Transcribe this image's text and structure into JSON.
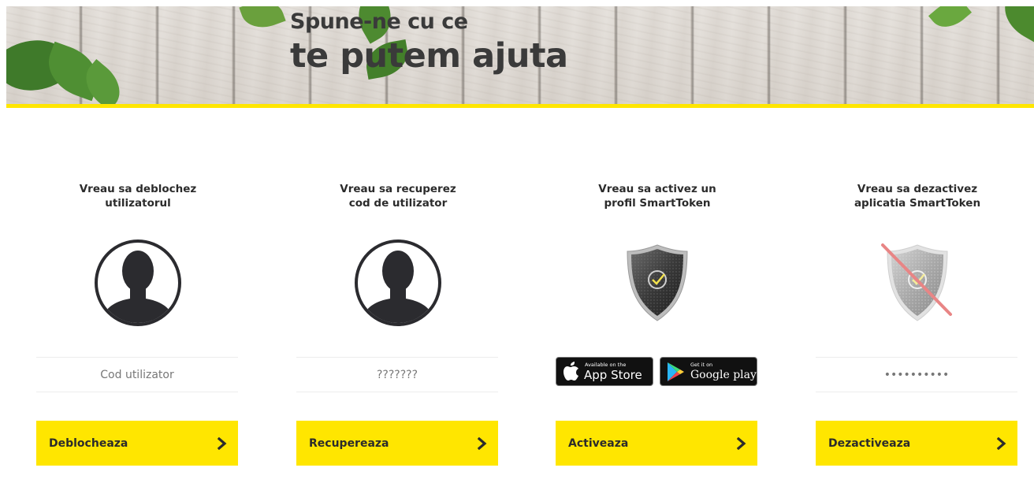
{
  "hero": {
    "title_line1": "Spune-ne cu ce",
    "title_line2": "te putem ajuta",
    "accent_color": "#ffe600"
  },
  "cards": [
    {
      "title_line1": "Vreau sa deblochez",
      "title_line2": "utilizatorul",
      "icon": "user-silhouette-icon",
      "input_placeholder": "Cod utilizator",
      "button_label": "Deblocheaza"
    },
    {
      "title_line1": "Vreau sa recuperez",
      "title_line2": "cod de utilizator",
      "icon": "user-silhouette-icon",
      "input_placeholder": "???????",
      "button_label": "Recupereaza"
    },
    {
      "title_line1": "Vreau sa activez un",
      "title_line2": "profil SmartToken",
      "icon": "shield-check-icon",
      "app_store": {
        "small": "Available on the",
        "big": "App Store"
      },
      "google_play": {
        "small": "Get it on",
        "big": "Google play"
      },
      "button_label": "Activeaza"
    },
    {
      "title_line1": "Vreau sa dezactivez",
      "title_line2": "aplicatia SmartToken",
      "icon": "shield-check-crossed-icon",
      "input_placeholder": "••••••••••",
      "button_label": "Dezactiveaza"
    }
  ],
  "colors": {
    "button_bg": "#ffe600",
    "text_dark": "#2b2b2b",
    "strike_red": "#e88585"
  }
}
